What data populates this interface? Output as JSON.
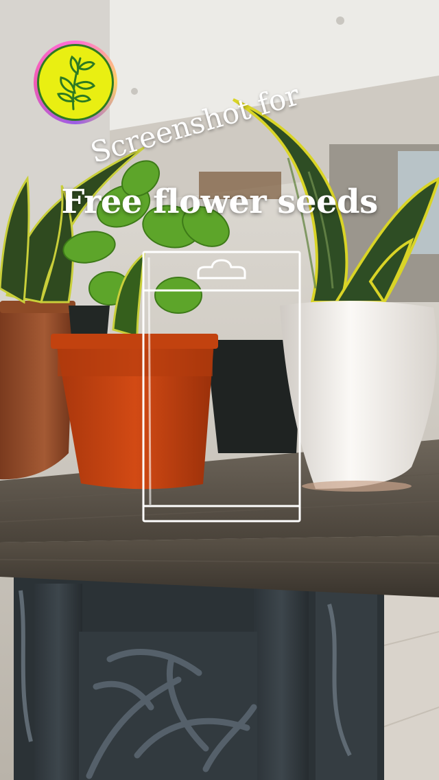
{
  "overlay": {
    "line1": "Screenshot for",
    "line2": "Free flower seeds"
  },
  "icons": {
    "logo": "sprout-leaf-icon",
    "packet": "seed-packet-outline-icon"
  },
  "colors": {
    "logo_fill": "#e9ef12",
    "logo_leaf": "#2d7a22",
    "text": "#ffffff"
  }
}
